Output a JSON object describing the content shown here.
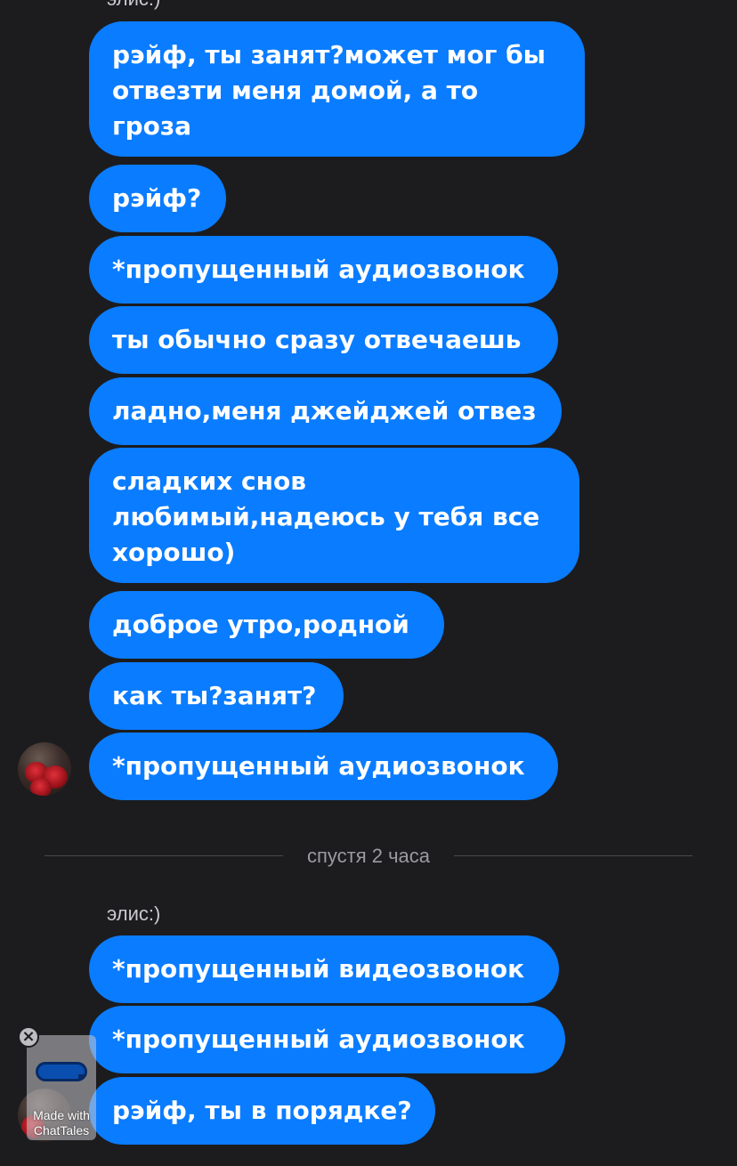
{
  "chat": {
    "top_sender": "элис:)",
    "messages_group1": [
      {
        "text": "рэйф, ты занят?может мог бы\nотвезти меня домой, а то\nгроза"
      },
      {
        "text": "рэйф?"
      },
      {
        "text": "*пропущенный аудиозвонок"
      },
      {
        "text": "ты обычно сразу отвечаешь"
      },
      {
        "text": "ладно,меня джейджей отвез"
      },
      {
        "text": "сладких снов\nлюбимый,надеюсь у тебя все\nхорошо)"
      },
      {
        "text": "доброе утро,родной"
      },
      {
        "text": "как ты?занят?"
      },
      {
        "text": "*пропущенный аудиозвонок"
      }
    ],
    "divider_label": "спустя 2 часа",
    "second_sender": "элис:)",
    "messages_group2": [
      {
        "text": "*пропущенный видеозвонок"
      },
      {
        "text": "*пропущенный аудиозвонок"
      },
      {
        "text": "рэйф, ты в порядке?"
      }
    ]
  },
  "watermark": {
    "line1": "Made with",
    "line2": "ChatTales",
    "close_glyph": "×"
  },
  "colors": {
    "background": "#1c1c1e",
    "bubble": "#0a7cff",
    "bubble_text": "#ffffff",
    "meta_text": "#9a9aa0"
  }
}
